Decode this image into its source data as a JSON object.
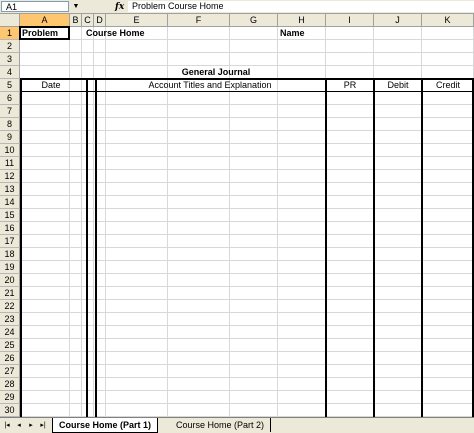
{
  "formula_bar": {
    "name_box": "A1",
    "fx_label": "fx",
    "formula": "Problem Course Home"
  },
  "columns": [
    {
      "id": "A",
      "w": 50
    },
    {
      "id": "B",
      "w": 12
    },
    {
      "id": "C",
      "w": 12
    },
    {
      "id": "D",
      "w": 12
    },
    {
      "id": "E",
      "w": 62
    },
    {
      "id": "F",
      "w": 62
    },
    {
      "id": "G",
      "w": 48
    },
    {
      "id": "H",
      "w": 48
    },
    {
      "id": "I",
      "w": 48
    },
    {
      "id": "J",
      "w": 48
    },
    {
      "id": "K",
      "w": 52
    }
  ],
  "rows": [
    "1",
    "2",
    "3",
    "4",
    "5",
    "6",
    "7",
    "8",
    "9",
    "10",
    "11",
    "12",
    "13",
    "14",
    "15",
    "16",
    "17",
    "18",
    "19",
    "20",
    "21",
    "22",
    "23",
    "24",
    "25",
    "26",
    "27",
    "28",
    "29",
    "30"
  ],
  "sheet": {
    "problem_label": "Problem",
    "course_label": "Course Home",
    "name_label": "Name",
    "journal_title": "General Journal",
    "headers": {
      "date": "Date",
      "account": "Account Titles and Explanation",
      "pr": "PR",
      "debit": "Debit",
      "credit": "Credit"
    }
  },
  "tabs": [
    {
      "label": "Course Home (Part 1)",
      "active": true
    },
    {
      "label": "Course Home (Part 2)",
      "active": false
    }
  ],
  "nav_buttons": [
    "|◂",
    "◂",
    "▸",
    "▸|"
  ]
}
